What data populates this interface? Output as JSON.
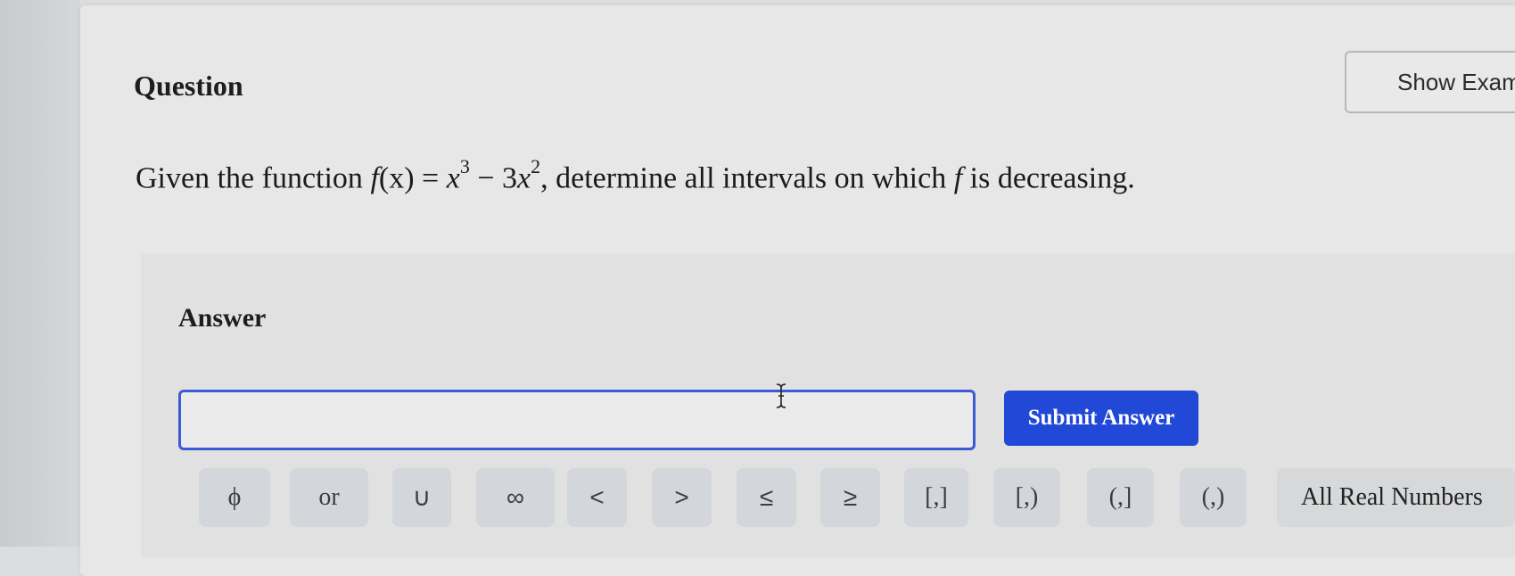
{
  "question": {
    "title": "Question",
    "show_button": "Show Exam",
    "prompt": {
      "before": "Given the function ",
      "function_name": "f",
      "function_arg": "(x)",
      "equals": " = ",
      "term1_base": "x",
      "term1_exp": "3",
      "minus": " − ",
      "term2_coef": "3",
      "term2_base": "x",
      "term2_exp": "2",
      "after": ", determine all intervals on which ",
      "var": "f",
      "end": " is decreasing."
    }
  },
  "answer": {
    "label": "Answer",
    "input_value": "",
    "submit_label": "Submit Answer"
  },
  "symbols": [
    {
      "label": "ϕ",
      "name": "empty-set"
    },
    {
      "label": "or",
      "name": "or"
    },
    {
      "label": "∪",
      "name": "union"
    },
    {
      "label": "∞",
      "name": "infinity"
    },
    {
      "label": "<",
      "name": "less-than"
    },
    {
      "label": ">",
      "name": "greater-than"
    },
    {
      "label": "≤",
      "name": "less-equal"
    },
    {
      "label": "≥",
      "name": "greater-equal"
    },
    {
      "label": "[,]",
      "name": "closed-interval"
    },
    {
      "label": "[,)",
      "name": "closed-open-interval"
    },
    {
      "label": "(,]",
      "name": "open-closed-interval"
    },
    {
      "label": "(,)",
      "name": "open-interval"
    },
    {
      "label": "All Real Numbers",
      "name": "all-real-numbers"
    }
  ],
  "colors": {
    "submit": "#2148d6",
    "input_border": "#3d5bd4",
    "symbol_bg": "#d3d6db"
  },
  "icons": {
    "text_cursor": "text-cursor-icon"
  }
}
